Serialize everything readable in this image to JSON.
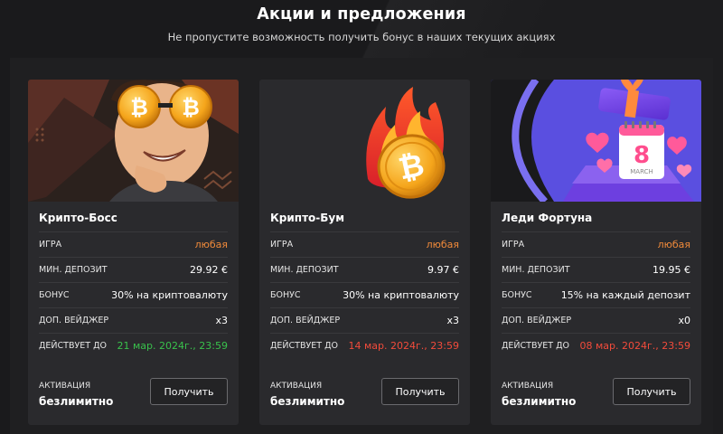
{
  "header": {
    "title": "Акции и предложения",
    "subtitle": "Не пропустите возможность получить бонус в наших текущих акциях"
  },
  "labels": {
    "game": "ИГРА",
    "min_deposit": "МИН. ДЕПОЗИТ",
    "bonus": "БОНУС",
    "wager": "ДОП. ВЕЙДЖЕР",
    "valid_until": "ДЕЙСТВУЕТ ДО",
    "activation": "АКТИВАЦИЯ",
    "button": "Получить"
  },
  "cards": [
    {
      "name": "Крипто-Босс",
      "game": "любая",
      "min_deposit": "29.92 €",
      "bonus": "30% на криптовалюту",
      "wager": "x3",
      "valid_until": "21 мар. 2024г., 23:59",
      "valid_until_color": "#39c14c",
      "activation": "безлимитно",
      "image_icon": "crypto-boss-character-icon"
    },
    {
      "name": "Крипто-Бум",
      "game": "любая",
      "min_deposit": "9.97 €",
      "bonus": "30% на криптовалюту",
      "wager": "x3",
      "valid_until": "14 мар. 2024г., 23:59",
      "valid_until_color": "#f24b3b",
      "activation": "безлимитно",
      "image_icon": "burning-bitcoin-icon"
    },
    {
      "name": "Леди Фортуна",
      "game": "любая",
      "min_deposit": "19.95 €",
      "bonus": "15% на каждый депозит",
      "wager": "x0",
      "valid_until": "08 мар. 2024г., 23:59",
      "valid_until_color": "#f24b3b",
      "activation": "безлимитно",
      "image_icon": "gift-box-calendar-icon",
      "image_calendar_day": "8",
      "image_calendar_month": "MARCH"
    }
  ],
  "colors": {
    "accent_orange": "#f08a3a",
    "active_green": "#39c14c",
    "expiring_red": "#f24b3b",
    "card_bg": "#2a2a2d"
  }
}
